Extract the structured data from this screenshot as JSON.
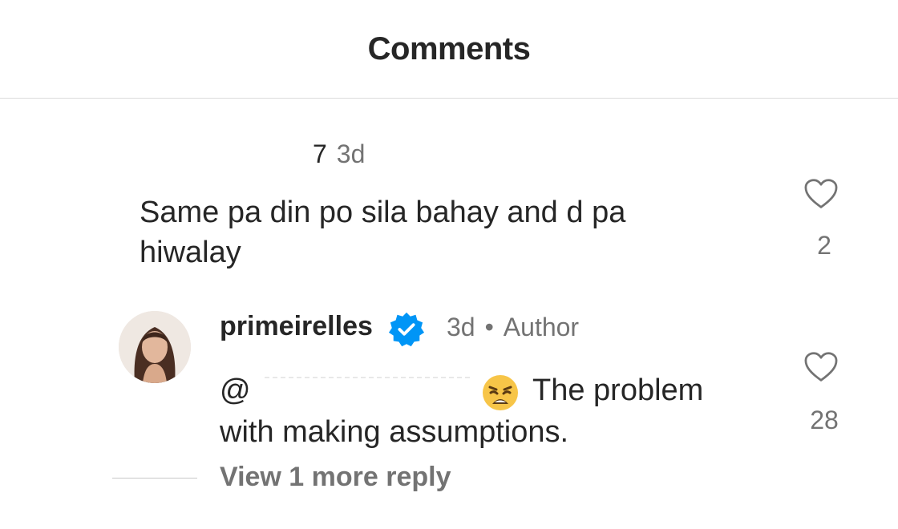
{
  "header": {
    "title": "Comments"
  },
  "comment1": {
    "like_count_prefix": "7",
    "time": "3d",
    "text_line1": "Same pa din po sila bahay and d pa",
    "text_line2": "hiwalay",
    "likes": "2",
    "heart_icon": "heart-outline-icon"
  },
  "comment2": {
    "username": "primeirelles",
    "verified_icon": "verified-badge-icon",
    "verified_color": "#0095f6",
    "time": "3d",
    "separator": "•",
    "role": "Author",
    "mention_prefix": "@",
    "emoji": "weary-face-emoji",
    "text_line1_tail": "The problem",
    "text_line2": "with making assumptions.",
    "likes": "28",
    "heart_icon": "heart-outline-icon"
  },
  "replies": {
    "view_more": "View 1 more reply"
  }
}
